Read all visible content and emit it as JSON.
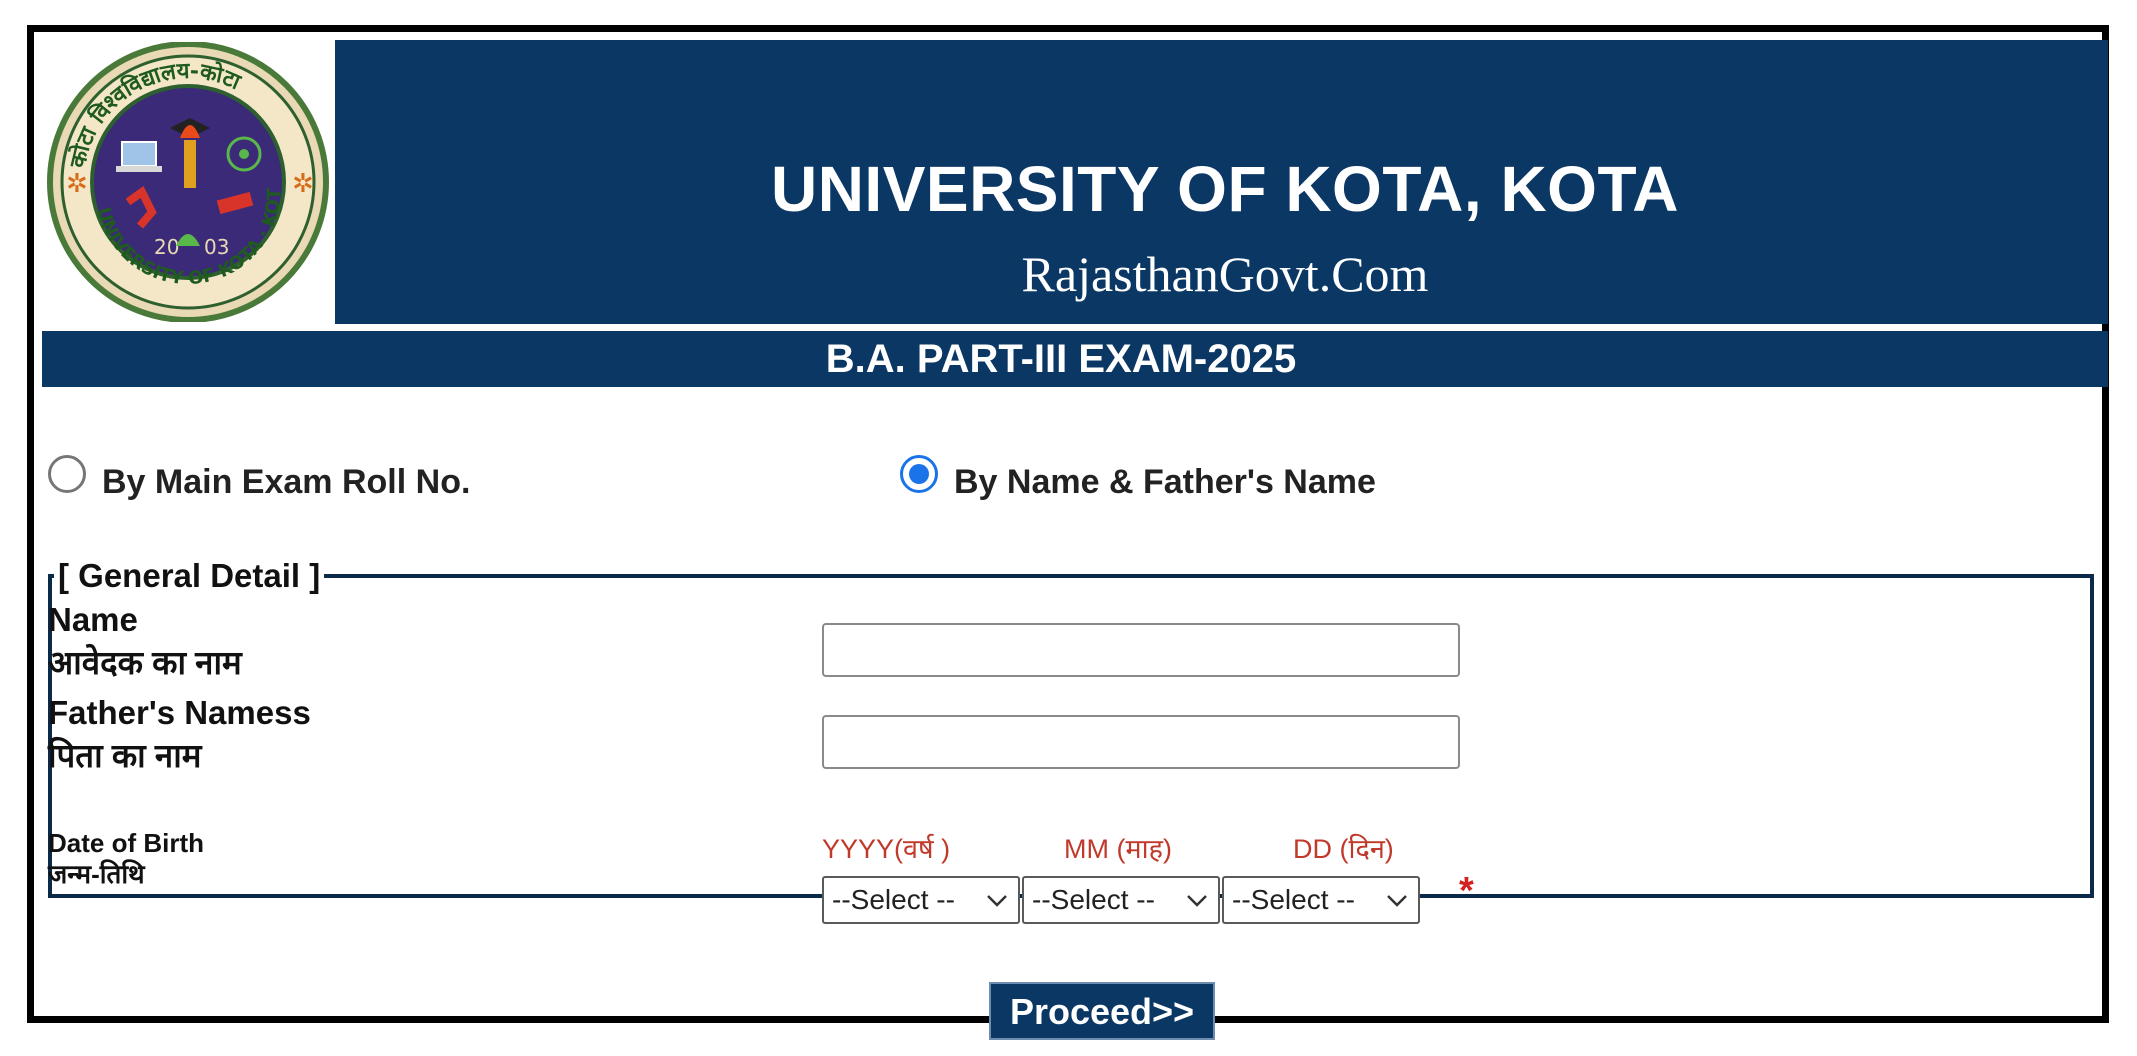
{
  "header": {
    "title": "UNIVERSITY OF KOTA, KOTA",
    "subtitle": "RajasthanGovt.Com",
    "logo": {
      "arc_text": "कोटा विश्वविद्यालय-कोटा",
      "bottom_text": "UNIVERSITY OF KOTA · KOTA",
      "year_left": "20",
      "year_right": "03"
    }
  },
  "exam_bar": {
    "label": "B.A. PART-III EXAM-2025"
  },
  "search_mode": {
    "options": [
      {
        "label": "By Main Exam Roll No.",
        "checked": false
      },
      {
        "label": "By Name & Father's Name",
        "checked": true
      }
    ]
  },
  "general_detail": {
    "legend": "[ General Detail ]",
    "name_label_en": "Name",
    "name_label_hi": "आवेदक का नाम",
    "name_value": "",
    "father_label_en": "Father's Namess",
    "father_label_hi": "पिता का नाम",
    "father_value": "",
    "dob_label_en": "Date of Birth",
    "dob_label_hi": "जन्म-तिथि",
    "dob_year_header": "YYYY(वर्ष )",
    "dob_month_header": "MM (माह)",
    "dob_day_header": "DD (दिन)",
    "year_select": "--Select --",
    "month_select": "--Select --",
    "day_select": "--Select --",
    "required_mark": "*"
  },
  "proceed_button": {
    "label": "Proceed>>"
  },
  "colors": {
    "brand_navy": "#0b3765",
    "radio_blue": "#1a73e8",
    "dob_header_red": "#c0392b",
    "required_red": "#d42222"
  }
}
